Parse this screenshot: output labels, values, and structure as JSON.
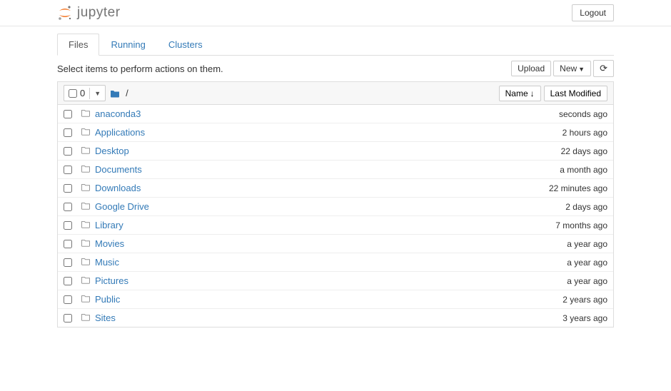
{
  "header": {
    "brand": "jupyter",
    "logout": "Logout"
  },
  "tabs": [
    {
      "label": "Files",
      "active": true
    },
    {
      "label": "Running",
      "active": false
    },
    {
      "label": "Clusters",
      "active": false
    }
  ],
  "toolbar": {
    "hint": "Select items to perform actions on them.",
    "upload": "Upload",
    "new": "New",
    "selected_count": "0",
    "breadcrumb_sep": "/",
    "sort_name": "Name",
    "sort_modified": "Last Modified"
  },
  "files": [
    {
      "name": "anaconda3",
      "modified": "seconds ago"
    },
    {
      "name": "Applications",
      "modified": "2 hours ago"
    },
    {
      "name": "Desktop",
      "modified": "22 days ago"
    },
    {
      "name": "Documents",
      "modified": "a month ago"
    },
    {
      "name": "Downloads",
      "modified": "22 minutes ago"
    },
    {
      "name": "Google Drive",
      "modified": "2 days ago"
    },
    {
      "name": "Library",
      "modified": "7 months ago"
    },
    {
      "name": "Movies",
      "modified": "a year ago"
    },
    {
      "name": "Music",
      "modified": "a year ago"
    },
    {
      "name": "Pictures",
      "modified": "a year ago"
    },
    {
      "name": "Public",
      "modified": "2 years ago"
    },
    {
      "name": "Sites",
      "modified": "3 years ago"
    }
  ]
}
